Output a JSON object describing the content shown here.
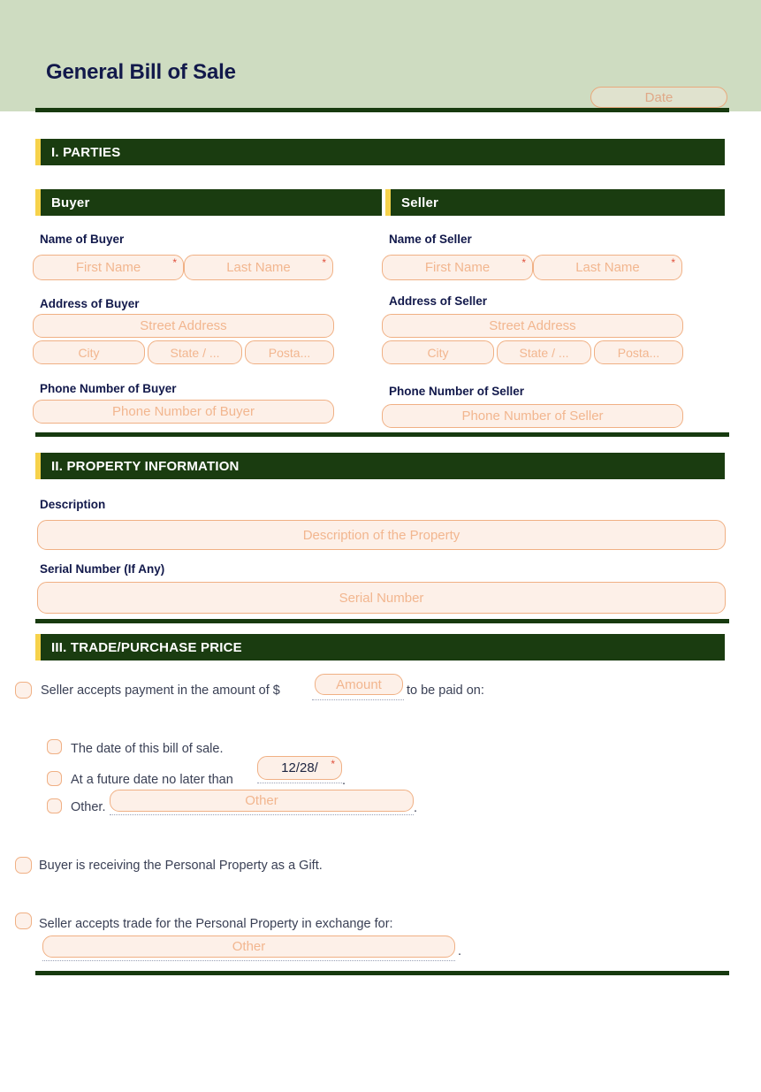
{
  "document": {
    "title": "General Bill of Sale",
    "header_bg": "#cedcc1",
    "title_color": "#12194b",
    "accent_color": "#f6d24b",
    "section_bg": "#1a3c10",
    "field_border": "#f0b084",
    "field_bg": "#fdf0e8",
    "placeholder_color": "#f2b68f",
    "required_color": "#e0503c"
  },
  "header": {
    "date": {
      "label": "Date",
      "placeholder": "Date",
      "value": ""
    }
  },
  "sections": {
    "parties": {
      "heading": "I. PARTIES",
      "buyer": {
        "heading": "Buyer",
        "name_label": "Name of Buyer",
        "first_name_placeholder": "First Name",
        "last_name_placeholder": "Last Name",
        "required_mark": "*",
        "address_label": "Address of Buyer",
        "street_placeholder": "Street Address",
        "city_placeholder": "City",
        "state_placeholder": "State / ...",
        "postal_placeholder": "Posta...",
        "phone_label": "Phone Number of Buyer",
        "phone_placeholder": "Phone Number of Buyer"
      },
      "seller": {
        "heading": "Seller",
        "name_label": "Name of Seller",
        "first_name_placeholder": "First Name",
        "last_name_placeholder": "Last Name",
        "required_mark": "*",
        "address_label": "Address of Seller",
        "street_placeholder": "Street Address",
        "city_placeholder": "City",
        "state_placeholder": "State / ...",
        "postal_placeholder": "Posta...",
        "phone_label": "Phone Number of Seller",
        "phone_placeholder": "Phone Number of Seller"
      }
    },
    "property": {
      "heading": "II. PROPERTY INFORMATION",
      "description_label": "Description",
      "description_placeholder": "Description of the Property",
      "serial_label": "Serial Number (If Any)",
      "serial_placeholder": "Serial Number"
    },
    "price": {
      "heading": "III. TRADE/PURCHASE PRICE",
      "option_payment": {
        "text_before": "Seller accepts payment in the amount of $",
        "amount_placeholder": "Amount",
        "text_after": "to be paid on:"
      },
      "sub_options": {
        "bill_date": "The date of this bill of sale.",
        "future_date_before": "At a future date no later than",
        "future_date_value": "12/28/",
        "future_date_required": "*",
        "future_date_after": ".",
        "other_label": "Other.",
        "other_placeholder": "Other",
        "other_after": "."
      },
      "option_gift": "Buyer is receiving the Personal Property as a Gift.",
      "option_trade": {
        "text": "Seller accepts trade for the Personal Property in exchange for:",
        "other_placeholder": "Other",
        "after": "."
      }
    }
  }
}
